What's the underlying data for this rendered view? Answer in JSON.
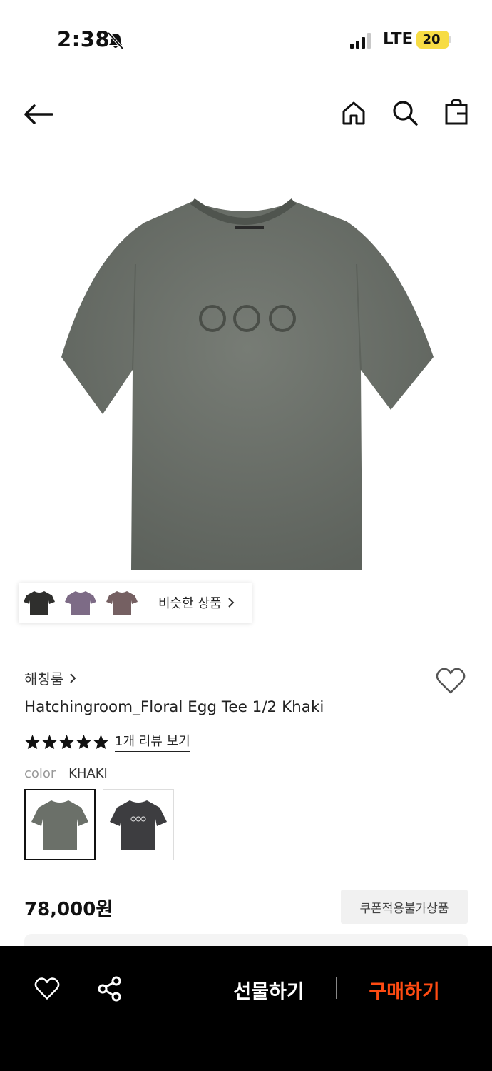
{
  "status_bar": {
    "time": "2:38",
    "network": "LTE",
    "battery": "20",
    "icons": [
      "bell-slash-icon",
      "signal-icon"
    ]
  },
  "nav": {
    "icons": [
      "back-arrow-icon",
      "home-icon",
      "search-icon",
      "shopping-bag-icon"
    ]
  },
  "gallery": {
    "similar_label": "비슷한 상품",
    "thumbnail_colors": [
      "#2f2f2d",
      "#7d6b86",
      "#756062"
    ]
  },
  "product": {
    "brand": "해칭룸",
    "title": "Hatchingroom_Floral Egg Tee 1/2 Khaki",
    "rating_stars": 5,
    "review_link": "1개 리뷰 보기",
    "color_label": "color",
    "color_value": "KHAKI",
    "options": [
      {
        "name": "KHAKI",
        "color": "#6b7069",
        "selected": true
      },
      {
        "name": "CHARCOAL",
        "color": "#3d3d40",
        "selected": false
      }
    ],
    "price": "78,000원",
    "coupon_note": "쿠폰적용불가상품"
  },
  "bottom_bar": {
    "gift_label": "선물하기",
    "buy_label": "구매하기",
    "buy_color": "#ff4b12",
    "icons": [
      "heart-icon",
      "share-icon"
    ]
  }
}
